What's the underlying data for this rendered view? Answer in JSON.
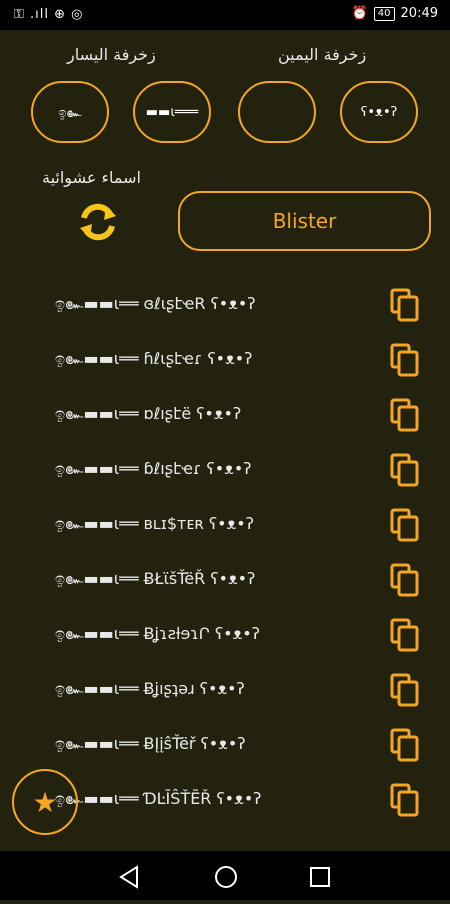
{
  "status": {
    "left": "⚿ .ıll ⊕ ◎",
    "time": "20:49",
    "battery": "40"
  },
  "labels": {
    "right_decoration": "زخرفة اليمين",
    "left_decoration": "زخرفة اليسار",
    "random_names": "اسماء عشوائية"
  },
  "deco_buttons": [
    {
      "symbol": "ඉ๛"
    },
    {
      "symbol": "▬▬ι═══"
    },
    {
      "symbol": ""
    },
    {
      "symbol": "ʕ•ᴥ•ʔ"
    }
  ],
  "input": {
    "value": "Blister"
  },
  "results": [
    {
      "text": "ඉ๛▬▬ι══ ɞℓιʂէҽR ʕ•ᴥ•ʔ"
    },
    {
      "text": "ඉ๛▬▬ι══ ɦℓιʂէҽɾ ʕ•ᴥ•ʔ"
    },
    {
      "text": "ඉ๛▬▬ι══ ɒℓıʂէë ʕ•ᴥ•ʔ"
    },
    {
      "text": "ඉ๛▬▬ι══ ɓℓıʂէҽɾ ʕ•ᴥ•ʔ"
    },
    {
      "text": "ඉ๛▬▬ι══ ʙʟɪ$ᴛᴇʀ ʕ•ᴥ•ʔ"
    },
    {
      "text": "ඉ๛▬▬ι══ ɃŁϊšŤëŘ ʕ•ᴥ•ʔ"
    },
    {
      "text": "ඉ๛▬▬ι══ ɃʝɿƨƚɘɿՐ ʕ•ᴥ•ʔ"
    },
    {
      "text": "ඉ๛▬▬ι══ Ƀʝıʂʇǝɹ ʕ•ᴥ•ʔ"
    },
    {
      "text": "ඉ๛▬▬ι══ ɃĮįŝŤëř ʕ•ᴥ•ʔ"
    },
    {
      "text": "ඉ๛▬▬ι══ ƊĿĪŜŤĒŘ ʕ•ᴥ•ʔ"
    }
  ],
  "fab": {
    "icon": "★"
  },
  "colors": {
    "accent": "#f5a623",
    "background": "#23220f"
  }
}
